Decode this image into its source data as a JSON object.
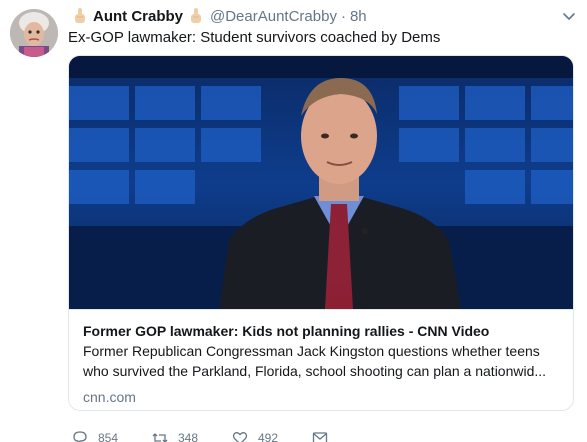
{
  "tweet": {
    "author": {
      "display_name": "Aunt Crabby",
      "handle": "@DearAuntCrabby",
      "name_emoji": "middle-finger-emoji"
    },
    "separator": "·",
    "time": "8h",
    "text": "Ex-GOP lawmaker: Student survivors coached by Dems",
    "card": {
      "title": "Former GOP lawmaker: Kids not planning rallies - CNN Video",
      "description_line1": "Former Republican Congressman Jack Kingston questions whether teens",
      "description_line2": "who survived the Parkland, Florida, school shooting can plan a nationwid...",
      "domain": "cnn.com"
    },
    "actions": {
      "reply_count": "854",
      "retweet_count": "348",
      "like_count": "492"
    }
  },
  "colors": {
    "text_primary": "#14171a",
    "text_secondary": "#657786",
    "border": "#e1e8ed"
  },
  "icons": [
    "reply-icon",
    "retweet-icon",
    "like-icon",
    "message-icon",
    "caret-down-icon"
  ]
}
